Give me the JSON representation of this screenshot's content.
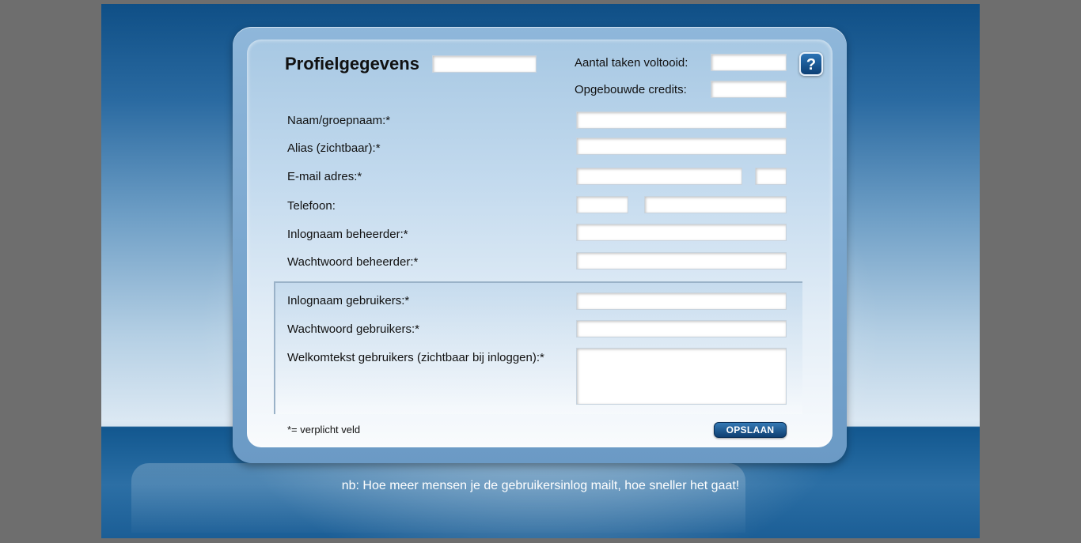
{
  "form": {
    "title": "Profielgegevens",
    "tasks_label": "Aantal taken voltooid:",
    "credits_label": "Opgebouwde credits:",
    "help_icon_glyph": "?",
    "fields": {
      "name_label": "Naam/groepnaam:*",
      "alias_label": "Alias (zichtbaar):*",
      "email_label": "E-mail adres:*",
      "phone_label": "Telefoon:",
      "admin_login_label": "Inlognaam beheerder:*",
      "admin_password_label": "Wachtwoord beheerder:*",
      "user_login_label": "Inlognaam gebruikers:*",
      "user_password_label": "Wachtwoord gebruikers:*",
      "welcome_label": "Welkomtekst gebruikers (zichtbaar bij inloggen):*"
    },
    "required_note": "*= verplicht veld",
    "save_label": "OPSLAAN"
  },
  "footer": {
    "note": "nb: Hoe meer mensen je de gebruikersinlog mailt, hoe sneller het gaat!"
  },
  "colors": {
    "accent_dark_blue": "#0f4f86",
    "button_blue": "#1f5c96"
  }
}
